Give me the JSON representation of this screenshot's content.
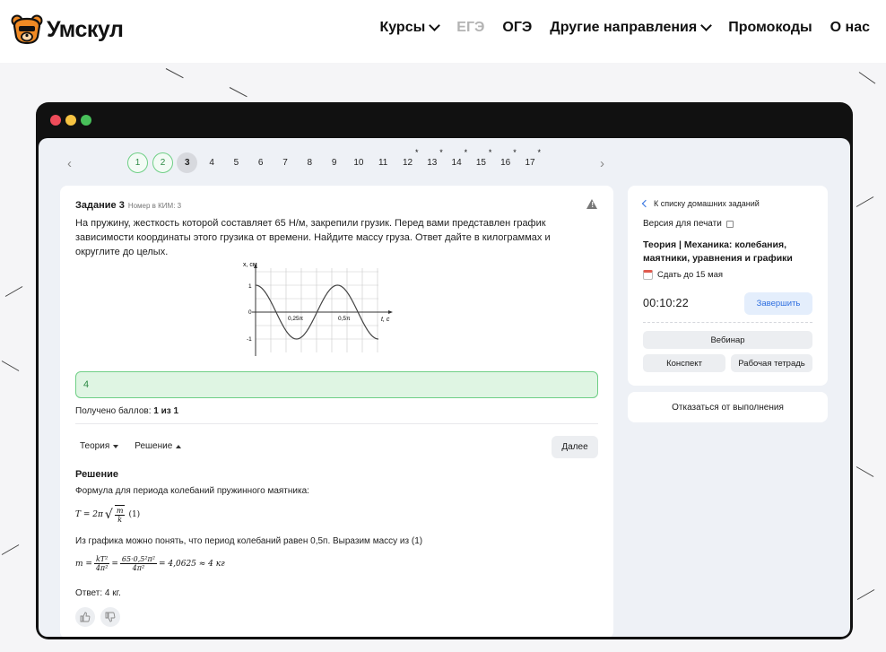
{
  "brand": {
    "name": "Умскул"
  },
  "nav": {
    "courses": "Курсы",
    "ege": "ЕГЭ",
    "oge": "ОГЭ",
    "other": "Другие направления",
    "promo": "Промокоды",
    "about": "О нас"
  },
  "pager": {
    "items": [
      {
        "label": "1",
        "state": "done"
      },
      {
        "label": "2",
        "state": "done"
      },
      {
        "label": "3",
        "state": "active"
      },
      {
        "label": "4"
      },
      {
        "label": "5"
      },
      {
        "label": "6"
      },
      {
        "label": "7"
      },
      {
        "label": "8"
      },
      {
        "label": "9"
      },
      {
        "label": "10"
      },
      {
        "label": "11"
      },
      {
        "label": "12",
        "star": true
      },
      {
        "label": "13",
        "star": true
      },
      {
        "label": "14",
        "star": true
      },
      {
        "label": "15",
        "star": true
      },
      {
        "label": "16",
        "star": true
      },
      {
        "label": "17",
        "star": true
      }
    ]
  },
  "task": {
    "title": "Задание 3",
    "kim": "Номер в КИМ: 3",
    "text": "На пружину, жесткость которой составляет 65 Н/м, закрепили грузик. Перед вами представлен график зависимости координаты этого грузика от времени. Найдите массу груза. Ответ дайте в килограммах и округлите до целых.",
    "graph": {
      "ylabel": "x, см",
      "xlabel": "t, с",
      "y_ticks": [
        "1",
        "0",
        "-1"
      ],
      "x_labels": [
        "0,25π",
        "0,5π"
      ]
    },
    "answer": "4",
    "score_label": "Получено баллов:",
    "score_value": "1 из 1"
  },
  "tabs": {
    "theory": "Теория",
    "solution": "Решение",
    "next": "Далее"
  },
  "solution": {
    "heading": "Решение",
    "line1": "Формула для периода колебаний пружинного маятника:",
    "formula1_lhs": "T = 2π",
    "formula1_num": "m",
    "formula1_den": "k",
    "formula1_tag": "(1)",
    "line2": "Из графика можно понять, что период колебаний равен 0,5п. Выразим массу из (1)",
    "formula2_lhs": "m =",
    "formula2_num1": "kT²",
    "formula2_den1": "4π²",
    "formula2_eq": "=",
    "formula2_num2": "65·0,5²π²",
    "formula2_den2": "4π²",
    "formula2_rhs": "= 4,0625 ≈ 4 кг",
    "answer_line": "Ответ: 4 кг."
  },
  "side": {
    "back": "К списку домашних заданий",
    "print": "Версия для печати",
    "theory_title": "Теория | Механика: колебания, маятники, уравнения и графики",
    "due": "Сдать до 15 мая",
    "timer": "00:10:22",
    "finish": "Завершить",
    "webinar": "Вебинар",
    "summary": "Конспект",
    "workbook": "Рабочая тетрадь",
    "refuse": "Отказаться от выполнения"
  },
  "colors": {
    "accent": "#2f6fe0",
    "success": "#6fcf86",
    "success_bg": "#dff5e3",
    "logo_orange": "#f08a24"
  }
}
